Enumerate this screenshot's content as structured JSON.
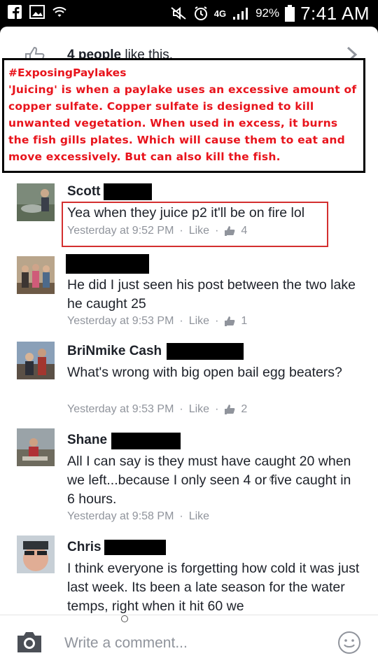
{
  "status_bar": {
    "battery": "92%",
    "time": "7:41 AM",
    "network": "4G",
    "icons": [
      "facebook-icon",
      "gallery-icon",
      "wifi-icon",
      "mute-icon",
      "alarm-icon",
      "lte-icon",
      "signal-icon",
      "battery-icon"
    ]
  },
  "likes": {
    "count_text": "4 people",
    "suffix": "like this."
  },
  "overlay": {
    "hashtag": "#ExposingPaylakes",
    "text": "'Juicing' is when a paylake uses an excessive amount of copper sulfate. Copper sulfate is designed to kill unwanted vegetation. When used in excess, it burns the fish gills plates. Which will cause them to eat and move excessively. But can also kill the fish.",
    "color": "#e8141c"
  },
  "comments": [
    {
      "name": "Scott",
      "text": "Yea when they juice p2 it'll be on fire lol",
      "time": "Yesterday at 9:52 PM",
      "like_label": "Like",
      "like_count": "4"
    },
    {
      "name": "",
      "text": "He did I just seen his post between the two lake he caught 25",
      "time": "Yesterday at 9:53 PM",
      "like_label": "Like",
      "like_count": "1"
    },
    {
      "name": "BriNmike Cash",
      "text": "What's wrong with big open bail egg beaters?",
      "time": "Yesterday at 9:53 PM",
      "like_label": "Like",
      "like_count": "2"
    },
    {
      "name": "Shane",
      "text": "All I can say is they must have caught 20 when we left...because I only seen 4 or five caught in 6 hours.",
      "time": "Yesterday at 9:58 PM",
      "like_label": "Like"
    },
    {
      "name": "Chris",
      "text": "I think everyone is forgetting how cold it was just last week. Its been a late season for the water temps, right when it hit 60 we"
    }
  ],
  "composer": {
    "placeholder": "Write a comment..."
  },
  "colors": {
    "meta_gray": "#90949c",
    "text": "#1d2129",
    "like_blue": "#90949c",
    "highlight_box": "#d32f2f"
  }
}
